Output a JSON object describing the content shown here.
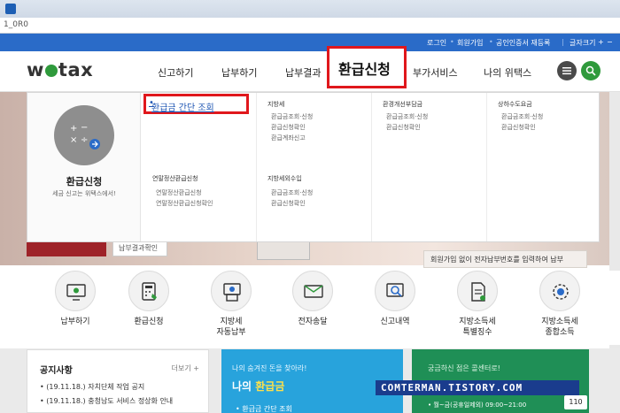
{
  "browser": {
    "address": "1_0R0"
  },
  "utility": {
    "items": [
      "로그인",
      "회원가입",
      "공인인증서 재등록",
      "글자크기"
    ],
    "font_plus": "+",
    "font_minus": "−"
  },
  "brand": {
    "name_left": "w",
    "name_right": "tax"
  },
  "nav": {
    "items": [
      "신고하기",
      "납부하기",
      "납부결과",
      "환급신청",
      "부가서비스",
      "나의 위택스"
    ]
  },
  "mega": {
    "title": "환급신청",
    "subtitle": "세금 신고는 위택스에서!",
    "quick_link": "환급금 간단 조회",
    "yearend": {
      "head": "연말정산환급신청",
      "items": [
        "연말정산환급신청",
        "연말정산환급신청확인"
      ]
    },
    "local_tax": {
      "head": "지방세",
      "items": [
        "환급금조회·신청",
        "환급신청확인",
        "환급계좌신고"
      ]
    },
    "local_non_tax": {
      "head": "지방세외수입",
      "items": [
        "환급금조회·신청",
        "환급신청확인"
      ]
    },
    "env_tax": {
      "head": "환경개선부담금",
      "items": [
        "환급금조회·신청",
        "환급신청확인"
      ]
    },
    "water_tax": {
      "head": "상하수도요금",
      "items": [
        "환급금조회·신청",
        "환급신청확인"
      ]
    }
  },
  "hero": {
    "chip_text": "납부결과확인",
    "notice": "회원가입 없이 전자납부번호를 입력하여 납부"
  },
  "services": [
    {
      "label": "납부하기"
    },
    {
      "label": "환급신청"
    },
    {
      "label": "지방세\n자동납부"
    },
    {
      "label": "전자송달"
    },
    {
      "label": "신고내역"
    },
    {
      "label": "지방소득세\n특별징수"
    },
    {
      "label": "지방소득세\n종합소득"
    }
  ],
  "notice_panel": {
    "title": "공지사항",
    "more": "더보기 +",
    "lines": [
      "(19.11.18.) 자치단체 작업 공지",
      "(19.11.18.) 충청남도 서비스 정상화 안내"
    ]
  },
  "refund_panel": {
    "sub": "나의 숨겨진 돈을 찾아라!",
    "title_prefix": "나의 ",
    "title_accent": "환급금",
    "link": "• 환급금 간단 조회"
  },
  "call_panel": {
    "sub": "궁금하신 점은 콜센터로!",
    "line": "• 월~금(공휴일제외)   09:00~21:00",
    "badge": "110"
  },
  "watermark": {
    "text": "COMTERMAN.TISTORY.COM"
  },
  "colors": {
    "blue": "#2a6bc8",
    "green": "#2f9a3c",
    "red": "#e0171c",
    "sky": "#28a3dc"
  }
}
